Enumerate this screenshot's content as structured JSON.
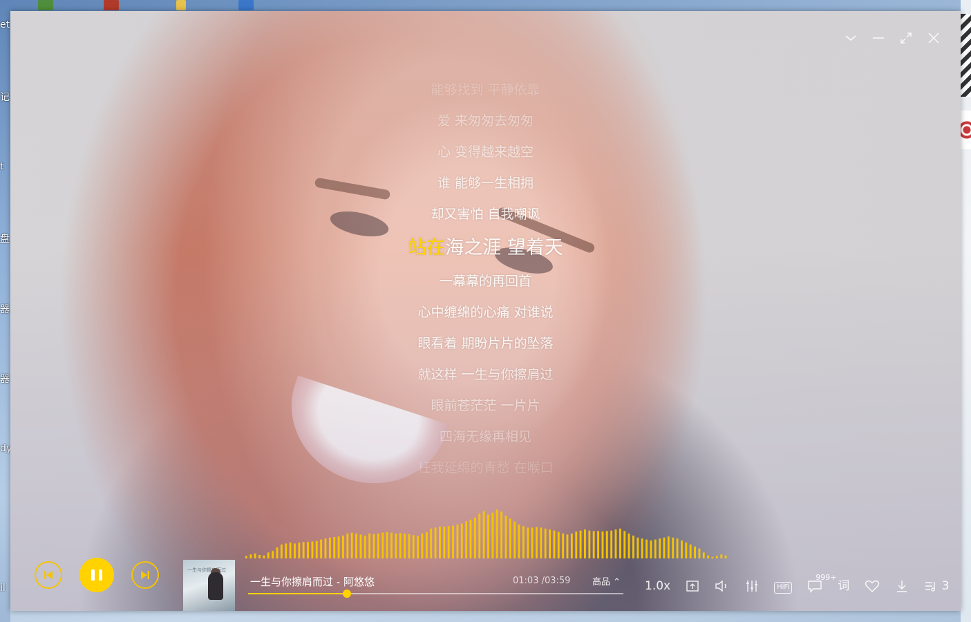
{
  "desktop": {
    "left_labels": [
      "et",
      "记",
      "t",
      "盘",
      "器",
      "器",
      "dy",
      "il"
    ]
  },
  "window_controls": {
    "collapse_icon": "chevron-down-icon",
    "minimize_icon": "minimize-icon",
    "maximize_icon": "expand-icon",
    "close_icon": "close-icon"
  },
  "lyrics": {
    "lines": [
      {
        "text": "能够找到 平静依靠",
        "opacity": 0.25
      },
      {
        "text": "爱 来匆匆去匆匆",
        "opacity": 0.45
      },
      {
        "text": "心 变得越来越空",
        "opacity": 0.6
      },
      {
        "text": "谁 能够一生相拥",
        "opacity": 0.8
      },
      {
        "text": "却又害怕 自我嘲讽",
        "opacity": 0.95
      },
      {
        "text": "一幕幕的再回首",
        "opacity": 0.95
      },
      {
        "text": "心中缠绵的心痛 对谁说",
        "opacity": 0.95
      },
      {
        "text": "眼看着 期盼片片的坠落",
        "opacity": 0.9
      },
      {
        "text": "就这样 一生与你擦肩过",
        "opacity": 0.75
      },
      {
        "text": "眼前苍茫茫 一片片",
        "opacity": 0.55
      },
      {
        "text": "四海无缘再相见",
        "opacity": 0.4
      },
      {
        "text": "枉我延绵的青愁 在喉口",
        "opacity": 0.22
      }
    ],
    "current": {
      "sung": "站在",
      "rest": "海之涯 望着天"
    },
    "highlight_color": "#ffd400"
  },
  "visualizer": {
    "color": "#f5c400",
    "levels": [
      0.05,
      0.08,
      0.1,
      0.07,
      0.06,
      0.12,
      0.15,
      0.22,
      0.28,
      0.3,
      0.32,
      0.3,
      0.32,
      0.33,
      0.33,
      0.34,
      0.35,
      0.38,
      0.4,
      0.42,
      0.43,
      0.44,
      0.46,
      0.5,
      0.52,
      0.5,
      0.48,
      0.46,
      0.5,
      0.49,
      0.5,
      0.52,
      0.53,
      0.52,
      0.5,
      0.51,
      0.5,
      0.49,
      0.47,
      0.45,
      0.5,
      0.53,
      0.6,
      0.62,
      0.64,
      0.64,
      0.65,
      0.66,
      0.68,
      0.7,
      0.75,
      0.78,
      0.82,
      0.9,
      0.95,
      0.88,
      0.92,
      0.98,
      0.94,
      0.86,
      0.8,
      0.74,
      0.68,
      0.65,
      0.62,
      0.62,
      0.63,
      0.62,
      0.6,
      0.58,
      0.56,
      0.53,
      0.5,
      0.48,
      0.5,
      0.54,
      0.56,
      0.58,
      0.56,
      0.55,
      0.55,
      0.54,
      0.55,
      0.56,
      0.58,
      0.6,
      0.55,
      0.5,
      0.46,
      0.42,
      0.4,
      0.38,
      0.36,
      0.38,
      0.4,
      0.42,
      0.44,
      0.42,
      0.4,
      0.36,
      0.32,
      0.28,
      0.24,
      0.2,
      0.12,
      0.06,
      0.03,
      0.05,
      0.08,
      0.06
    ]
  },
  "player": {
    "prev_icon": "skip-previous-icon",
    "pause_icon": "pause-icon",
    "next_icon": "skip-next-icon",
    "accent": "#ffd200",
    "song_title": "一生与你擦肩而过 - 阿悠悠",
    "elapsed": "01:03",
    "time_separator": " /",
    "duration": "03:59",
    "quality": "高品 ⌃",
    "progress": 0.2636,
    "album_caption": "一生与你擦肩而过"
  },
  "tools": {
    "speed": "1.0x",
    "comment_count": "999+",
    "playlist_count": "3",
    "hifi_label": "HiFi",
    "lyric_label": "词"
  }
}
